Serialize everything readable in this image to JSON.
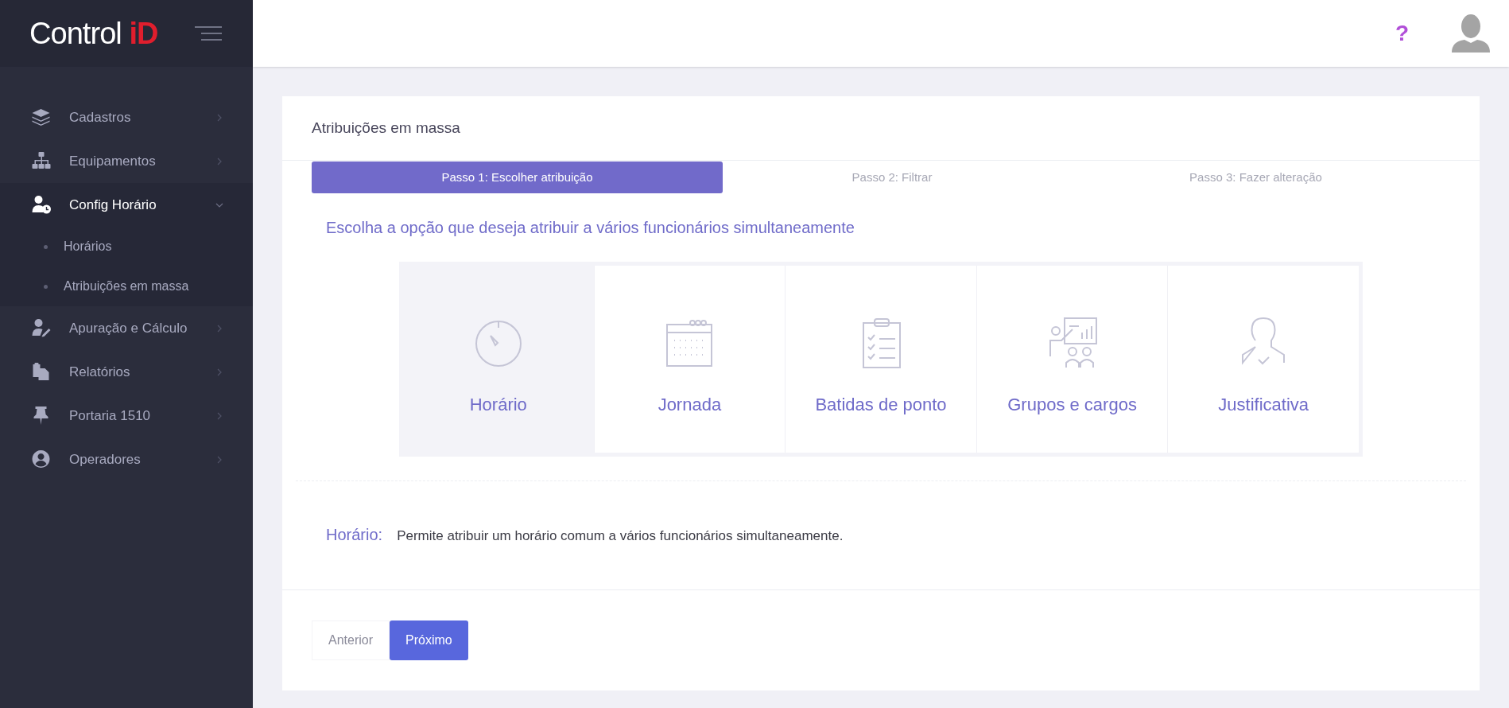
{
  "sidebar": {
    "logo": {
      "text": "Control",
      "accent": "iD"
    },
    "items": [
      {
        "label": "Cadastros",
        "selected": false,
        "expanded": false
      },
      {
        "label": "Equipamentos",
        "selected": false,
        "expanded": false
      },
      {
        "label": "Config Horário",
        "selected": true,
        "expanded": true,
        "children": [
          {
            "label": "Horários",
            "selected": false
          },
          {
            "label": "Atribuições em massa",
            "selected": false
          }
        ]
      },
      {
        "label": "Apuração e Cálculo",
        "selected": false,
        "expanded": false
      },
      {
        "label": "Relatórios",
        "selected": false,
        "expanded": false
      },
      {
        "label": "Portaria 1510",
        "selected": false,
        "expanded": false
      },
      {
        "label": "Operadores",
        "selected": false,
        "expanded": false
      }
    ]
  },
  "header": {
    "help": "?"
  },
  "card": {
    "title": "Atribuições em massa",
    "steps": [
      {
        "label": "Passo 1: Escolher atribuição",
        "selected": true
      },
      {
        "label": "Passo 2: Filtrar",
        "selected": false
      },
      {
        "label": "Passo 3: Fazer alteração",
        "selected": false
      }
    ],
    "prompt": "Escolha a opção que deseja atribuir a vários funcionários simultaneamente",
    "options": [
      {
        "label": "Horário",
        "selected": true
      },
      {
        "label": "Jornada",
        "selected": false
      },
      {
        "label": "Batidas de ponto",
        "selected": false
      },
      {
        "label": "Grupos e cargos",
        "selected": false
      },
      {
        "label": "Justificativa",
        "selected": false
      }
    ],
    "description": {
      "label": "Horário:",
      "text": "Permite atribuir um horário comum a vários funcionários simultaneamente."
    },
    "buttons": [
      {
        "label": "Anterior",
        "kind": "secondary"
      },
      {
        "label": "Próximo",
        "kind": "primary"
      }
    ]
  }
}
